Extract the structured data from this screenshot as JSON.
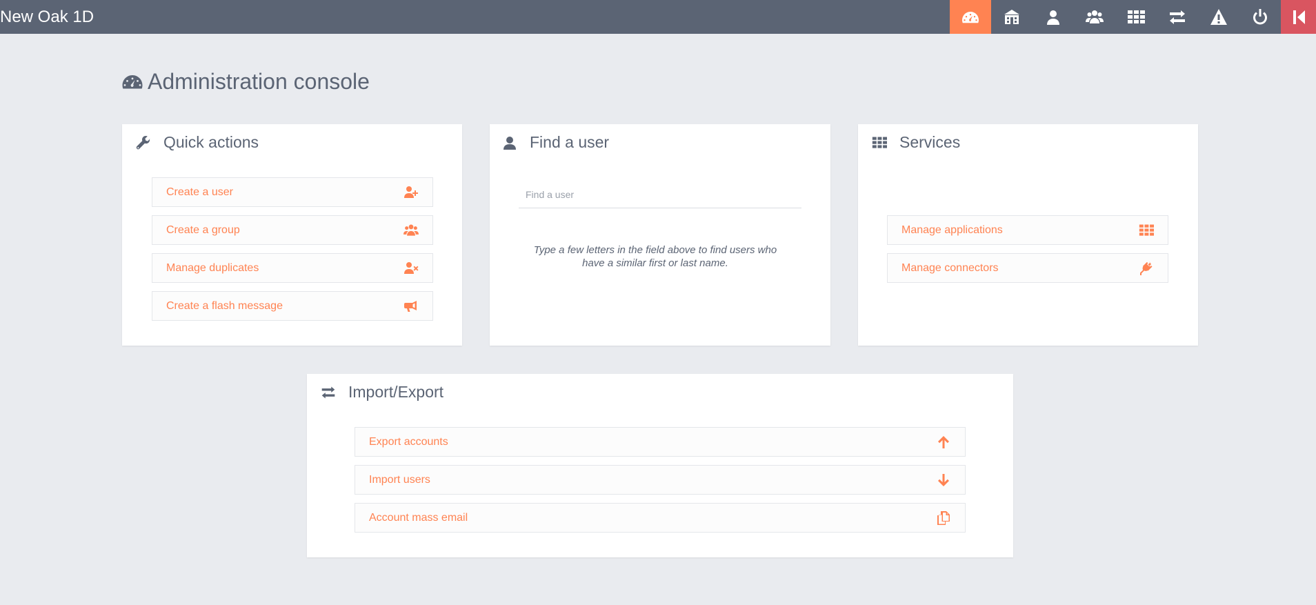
{
  "app": {
    "title": "New Oak 1D"
  },
  "nav": {
    "items": [
      {
        "icon": "dashboard-icon",
        "active": true
      },
      {
        "icon": "school-icon"
      },
      {
        "icon": "user-icon"
      },
      {
        "icon": "group-icon"
      },
      {
        "icon": "apps-grid-icon"
      },
      {
        "icon": "exchange-icon"
      },
      {
        "icon": "warning-icon"
      },
      {
        "icon": "power-icon"
      },
      {
        "icon": "exit-icon"
      }
    ]
  },
  "page": {
    "title": "Administration console"
  },
  "quick_actions": {
    "title": "Quick actions",
    "items": [
      {
        "label": "Create a user",
        "icon": "user-plus-icon"
      },
      {
        "label": "Create a group",
        "icon": "group-icon"
      },
      {
        "label": "Manage duplicates",
        "icon": "user-times-icon"
      },
      {
        "label": "Create a flash message",
        "icon": "bullhorn-icon"
      }
    ]
  },
  "find_user": {
    "title": "Find a user",
    "placeholder": "Find a user",
    "hint": "Type a few letters in the field above to find users who have a similar first or last name."
  },
  "services": {
    "title": "Services",
    "items": [
      {
        "label": "Manage applications",
        "icon": "apps-grid-icon"
      },
      {
        "label": "Manage connectors",
        "icon": "plug-icon"
      }
    ]
  },
  "import_export": {
    "title": "Import/Export",
    "items": [
      {
        "label": "Export accounts",
        "icon": "arrow-up-icon"
      },
      {
        "label": "Import users",
        "icon": "arrow-down-icon"
      },
      {
        "label": "Account mass email",
        "icon": "copy-icon"
      }
    ]
  },
  "colors": {
    "topbar": "#5b6474",
    "accent": "#ff8352",
    "exit": "#d95560",
    "background": "#e9ebef"
  }
}
